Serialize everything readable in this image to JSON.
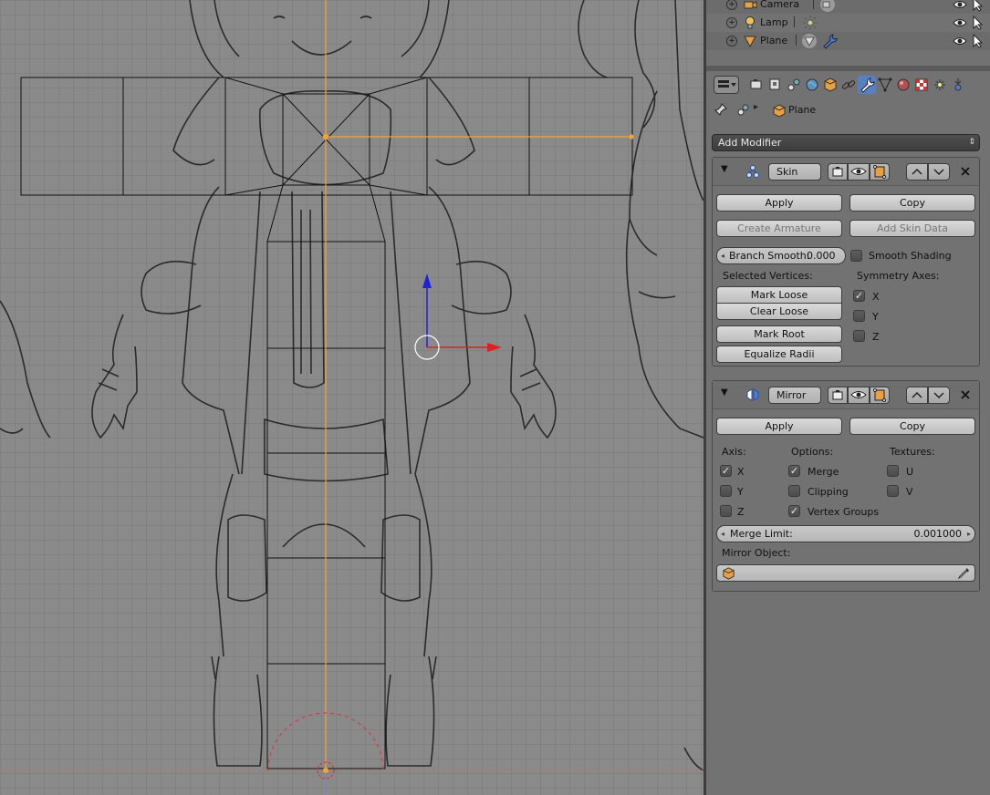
{
  "outliner": {
    "rows": [
      {
        "label": "Camera"
      },
      {
        "label": "Lamp"
      },
      {
        "label": "Plane"
      }
    ]
  },
  "breadcrumb": {
    "object": "Plane"
  },
  "add_modifier": {
    "label": "Add Modifier"
  },
  "skin": {
    "name": "Skin",
    "apply": "Apply",
    "copy": "Copy",
    "create_armature": "Create Armature",
    "add_skin_data": "Add Skin Data",
    "branch_smooth_label": "Branch Smooth:",
    "branch_smooth_value": "0.000",
    "smooth_shading": "Smooth Shading",
    "selected_vertices": "Selected Vertices:",
    "symmetry_axes": "Symmetry Axes:",
    "mark_loose": "Mark Loose",
    "clear_loose": "Clear Loose",
    "mark_root": "Mark Root",
    "equalize_radii": "Equalize Radii",
    "axis_x": "X",
    "axis_y": "Y",
    "axis_z": "Z",
    "symmetry": {
      "x": true,
      "y": false,
      "z": false
    },
    "smooth_shading_checked": false
  },
  "mirror": {
    "name": "Mirror",
    "apply": "Apply",
    "copy": "Copy",
    "axis_header": "Axis:",
    "options_header": "Options:",
    "textures_header": "Textures:",
    "axis_x": "X",
    "axis_y": "Y",
    "axis_z": "Z",
    "merge": "Merge",
    "clipping": "Clipping",
    "vertex_groups": "Vertex Groups",
    "tex_u": "U",
    "tex_v": "V",
    "merge_limit_label": "Merge Limit:",
    "merge_limit_value": "0.001000",
    "mirror_object_label": "Mirror Object:",
    "checks": {
      "x": true,
      "y": false,
      "z": false,
      "merge": true,
      "clipping": false,
      "vertex_groups": true,
      "u": false,
      "v": false
    }
  },
  "colors": {
    "viewport_bg": "#8a8a8a",
    "panel_bg": "#727272",
    "active_tab": "#5680c2",
    "selection_orange": "#f3a33b",
    "gizmo_red": "#e02020",
    "gizmo_blue": "#2020d8"
  },
  "icons": [
    "camera-icon",
    "lamp-icon",
    "mesh-icon",
    "eye-icon",
    "cursor-icon",
    "wrench-icon",
    "pin-icon",
    "cube-icon",
    "skin-icon",
    "mirror-icon",
    "eyedropper-icon",
    "close-icon"
  ]
}
